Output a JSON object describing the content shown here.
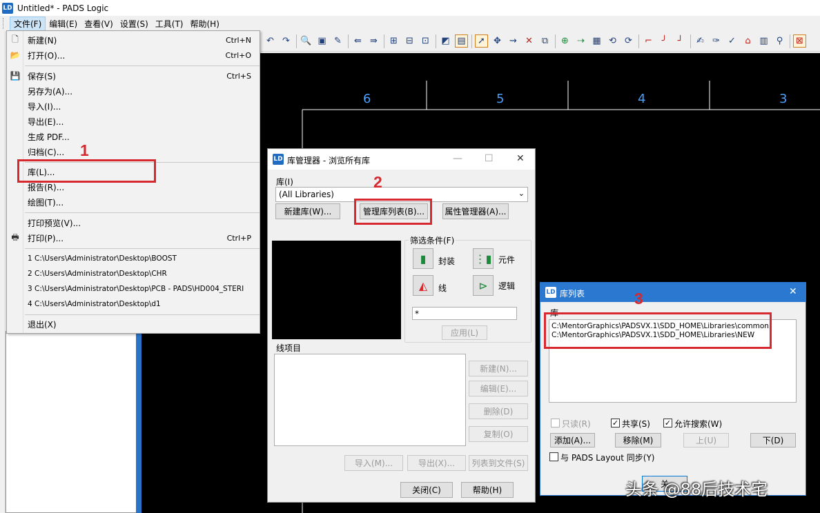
{
  "window": {
    "title": "Untitled* - PADS Logic",
    "app_icon": "pads-logo-icon"
  },
  "menubar": [
    "文件(F)",
    "编辑(E)",
    "查看(V)",
    "设置(S)",
    "工具(T)",
    "帮助(H)"
  ],
  "file_menu": {
    "items": [
      {
        "label": "新建(N)",
        "shortcut": "Ctrl+N",
        "icon": "new-file-icon"
      },
      {
        "label": "打开(O)...",
        "shortcut": "Ctrl+O",
        "icon": "open-folder-icon"
      },
      {
        "label": "保存(S)",
        "shortcut": "Ctrl+S",
        "icon": "save-icon"
      },
      {
        "label": "另存为(A)...",
        "shortcut": ""
      },
      {
        "label": "导入(I)...",
        "shortcut": ""
      },
      {
        "label": "导出(E)...",
        "shortcut": ""
      },
      {
        "label": "生成 PDF...",
        "shortcut": ""
      },
      {
        "label": "归档(C)...",
        "shortcut": ""
      },
      {
        "label": "库(L)...",
        "shortcut": ""
      },
      {
        "label": "报告(R)...",
        "shortcut": ""
      },
      {
        "label": "绘图(T)...",
        "shortcut": ""
      },
      {
        "label": "打印预览(V)...",
        "shortcut": ""
      },
      {
        "label": "打印(P)...",
        "shortcut": "Ctrl+P",
        "icon": "printer-icon"
      },
      {
        "label": "退出(X)",
        "shortcut": ""
      }
    ],
    "recent_files": [
      "1 C:\\Users\\Administrator\\Desktop\\BOOST",
      "2 C:\\Users\\Administrator\\Desktop\\CHR",
      "3 C:\\Users\\Administrator\\Desktop\\PCB - PADS\\HD004_STERI",
      "4 C:\\Users\\Administrator\\Desktop\\d1"
    ]
  },
  "canvas": {
    "zone_numbers": [
      "6",
      "5",
      "4",
      "3"
    ]
  },
  "annotations": {
    "step1": "1",
    "step2": "2",
    "step3": "3",
    "color": "#d6282e"
  },
  "library_manager": {
    "title": "库管理器 - 浏览所有库",
    "library_label": "库(I)",
    "library_selected": "(All Libraries)",
    "new_library_btn": "新建库(W)...",
    "manage_list_btn": "管理库列表(B)...",
    "attr_manager_btn": "属性管理器(A)...",
    "filter_label": "筛选条件(F)",
    "filters": {
      "package": "封装",
      "part": "元件",
      "line": "线",
      "logic": "逻辑"
    },
    "filter_value": "*",
    "apply_btn": "应用(L)",
    "items_label": "线项目",
    "new_btn": "新建(N)...",
    "edit_btn": "编辑(E)...",
    "delete_btn": "删除(D)",
    "copy_btn": "复制(O)",
    "import_btn": "导入(M)...",
    "export_btn": "导出(X)...",
    "list_to_file_btn": "列表到文件(S)",
    "close_btn": "关闭(C)",
    "help_btn": "帮助(H)"
  },
  "library_list": {
    "title": "库列表",
    "lib_label": "库",
    "entries": [
      "C:\\MentorGraphics\\PADSVX.1\\SDD_HOME\\Libraries\\common",
      "C:\\MentorGraphics\\PADSVX.1\\SDD_HOME\\Libraries\\NEW"
    ],
    "readonly_label": "只读(R)",
    "shared_label": "共享(S)",
    "allow_search_label": "允许搜索(W)",
    "shared_checked": true,
    "allow_search_checked": true,
    "add_btn": "添加(A)...",
    "remove_btn": "移除(M)",
    "up_btn": "上(U)",
    "down_btn": "下(D)",
    "sync_label": "与 PADS Layout 同步(Y)",
    "close_btn_partial": "关"
  },
  "watermark": "头条 @88后技术宅"
}
